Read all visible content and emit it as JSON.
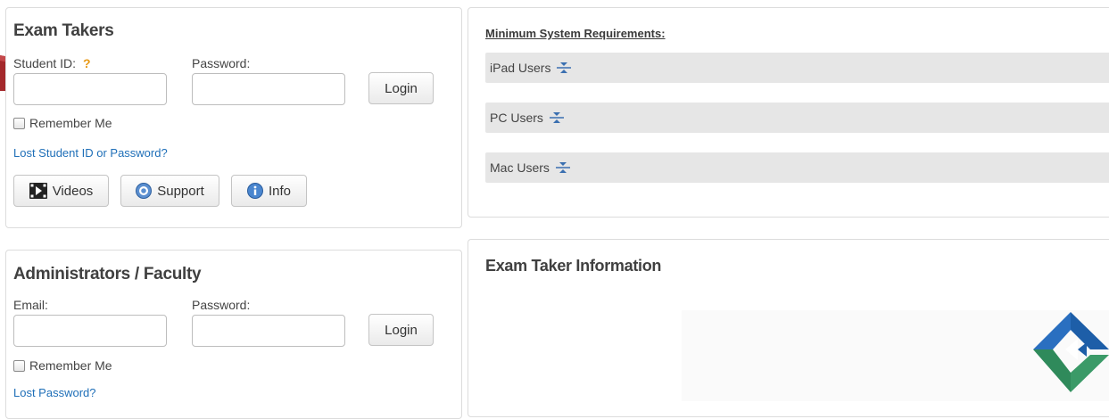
{
  "exam_takers": {
    "title": "Exam Takers",
    "student_id_label": "Student ID:",
    "help_mark": "?",
    "password_label": "Password:",
    "student_id_value": "",
    "password_value": "",
    "login_label": "Login",
    "remember_label": "Remember Me",
    "remember_checked": false,
    "lost_link": "Lost Student ID or Password?",
    "buttons": [
      {
        "label": "Videos",
        "icon": "video-icon"
      },
      {
        "label": "Support",
        "icon": "support-icon"
      },
      {
        "label": "Info",
        "icon": "info-icon"
      }
    ]
  },
  "requirements": {
    "title": "Minimum System Requirements:",
    "items": [
      {
        "label": "iPad Users",
        "icon": "expand-icon"
      },
      {
        "label": "PC Users",
        "icon": "expand-icon"
      },
      {
        "label": "Mac Users",
        "icon": "expand-icon"
      }
    ]
  },
  "administrators": {
    "title": "Administrators / Faculty",
    "email_label": "Email:",
    "password_label": "Password:",
    "email_value": "",
    "password_value": "",
    "login_label": "Login",
    "remember_label": "Remember Me",
    "remember_checked": false,
    "lost_link": "Lost Password?"
  },
  "exam_taker_info": {
    "title": "Exam Taker Information"
  },
  "colors": {
    "link": "#1f6fb8",
    "help_mark": "#e89a17",
    "arrow": "#a3282b",
    "logo_blue": "#1d5ea8",
    "logo_green": "#2f8a5b"
  }
}
